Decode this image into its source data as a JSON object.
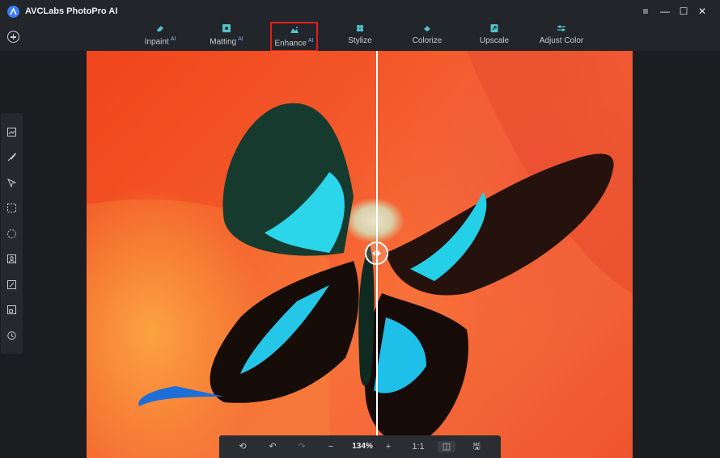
{
  "app": {
    "title": "AVCLabs PhotoPro AI"
  },
  "window_controls": {
    "menu": "≡",
    "minimize": "—",
    "maximize": "☐",
    "close": "✕"
  },
  "toolbar": {
    "tools": [
      {
        "label": "Inpaint",
        "badge": "AI"
      },
      {
        "label": "Matting",
        "badge": "AI"
      },
      {
        "label": "Enhance",
        "badge": "AI"
      },
      {
        "label": "Stylize",
        "badge": ""
      },
      {
        "label": "Colorize",
        "badge": ""
      },
      {
        "label": "Upscale",
        "badge": ""
      },
      {
        "label": "Adjust Color",
        "badge": ""
      }
    ],
    "active_tool": "Enhance"
  },
  "sidebar": {
    "icons": [
      "image-adjust-icon",
      "brush-icon",
      "select-arrow-icon",
      "rect-select-icon",
      "lasso-select-icon",
      "portrait-icon",
      "edit-image-icon",
      "layers-icon",
      "history-icon"
    ]
  },
  "bottombar": {
    "reset": "⟲",
    "undo": "↶",
    "redo": "↷",
    "zoom_out": "−",
    "zoom": "134%",
    "zoom_in": "+",
    "actual_size": "1:1",
    "compare": "◫",
    "save": "🖫"
  },
  "colors": {
    "accent": "#3a7bff",
    "highlight": "#e01e1e",
    "background": "#1b1d21"
  }
}
